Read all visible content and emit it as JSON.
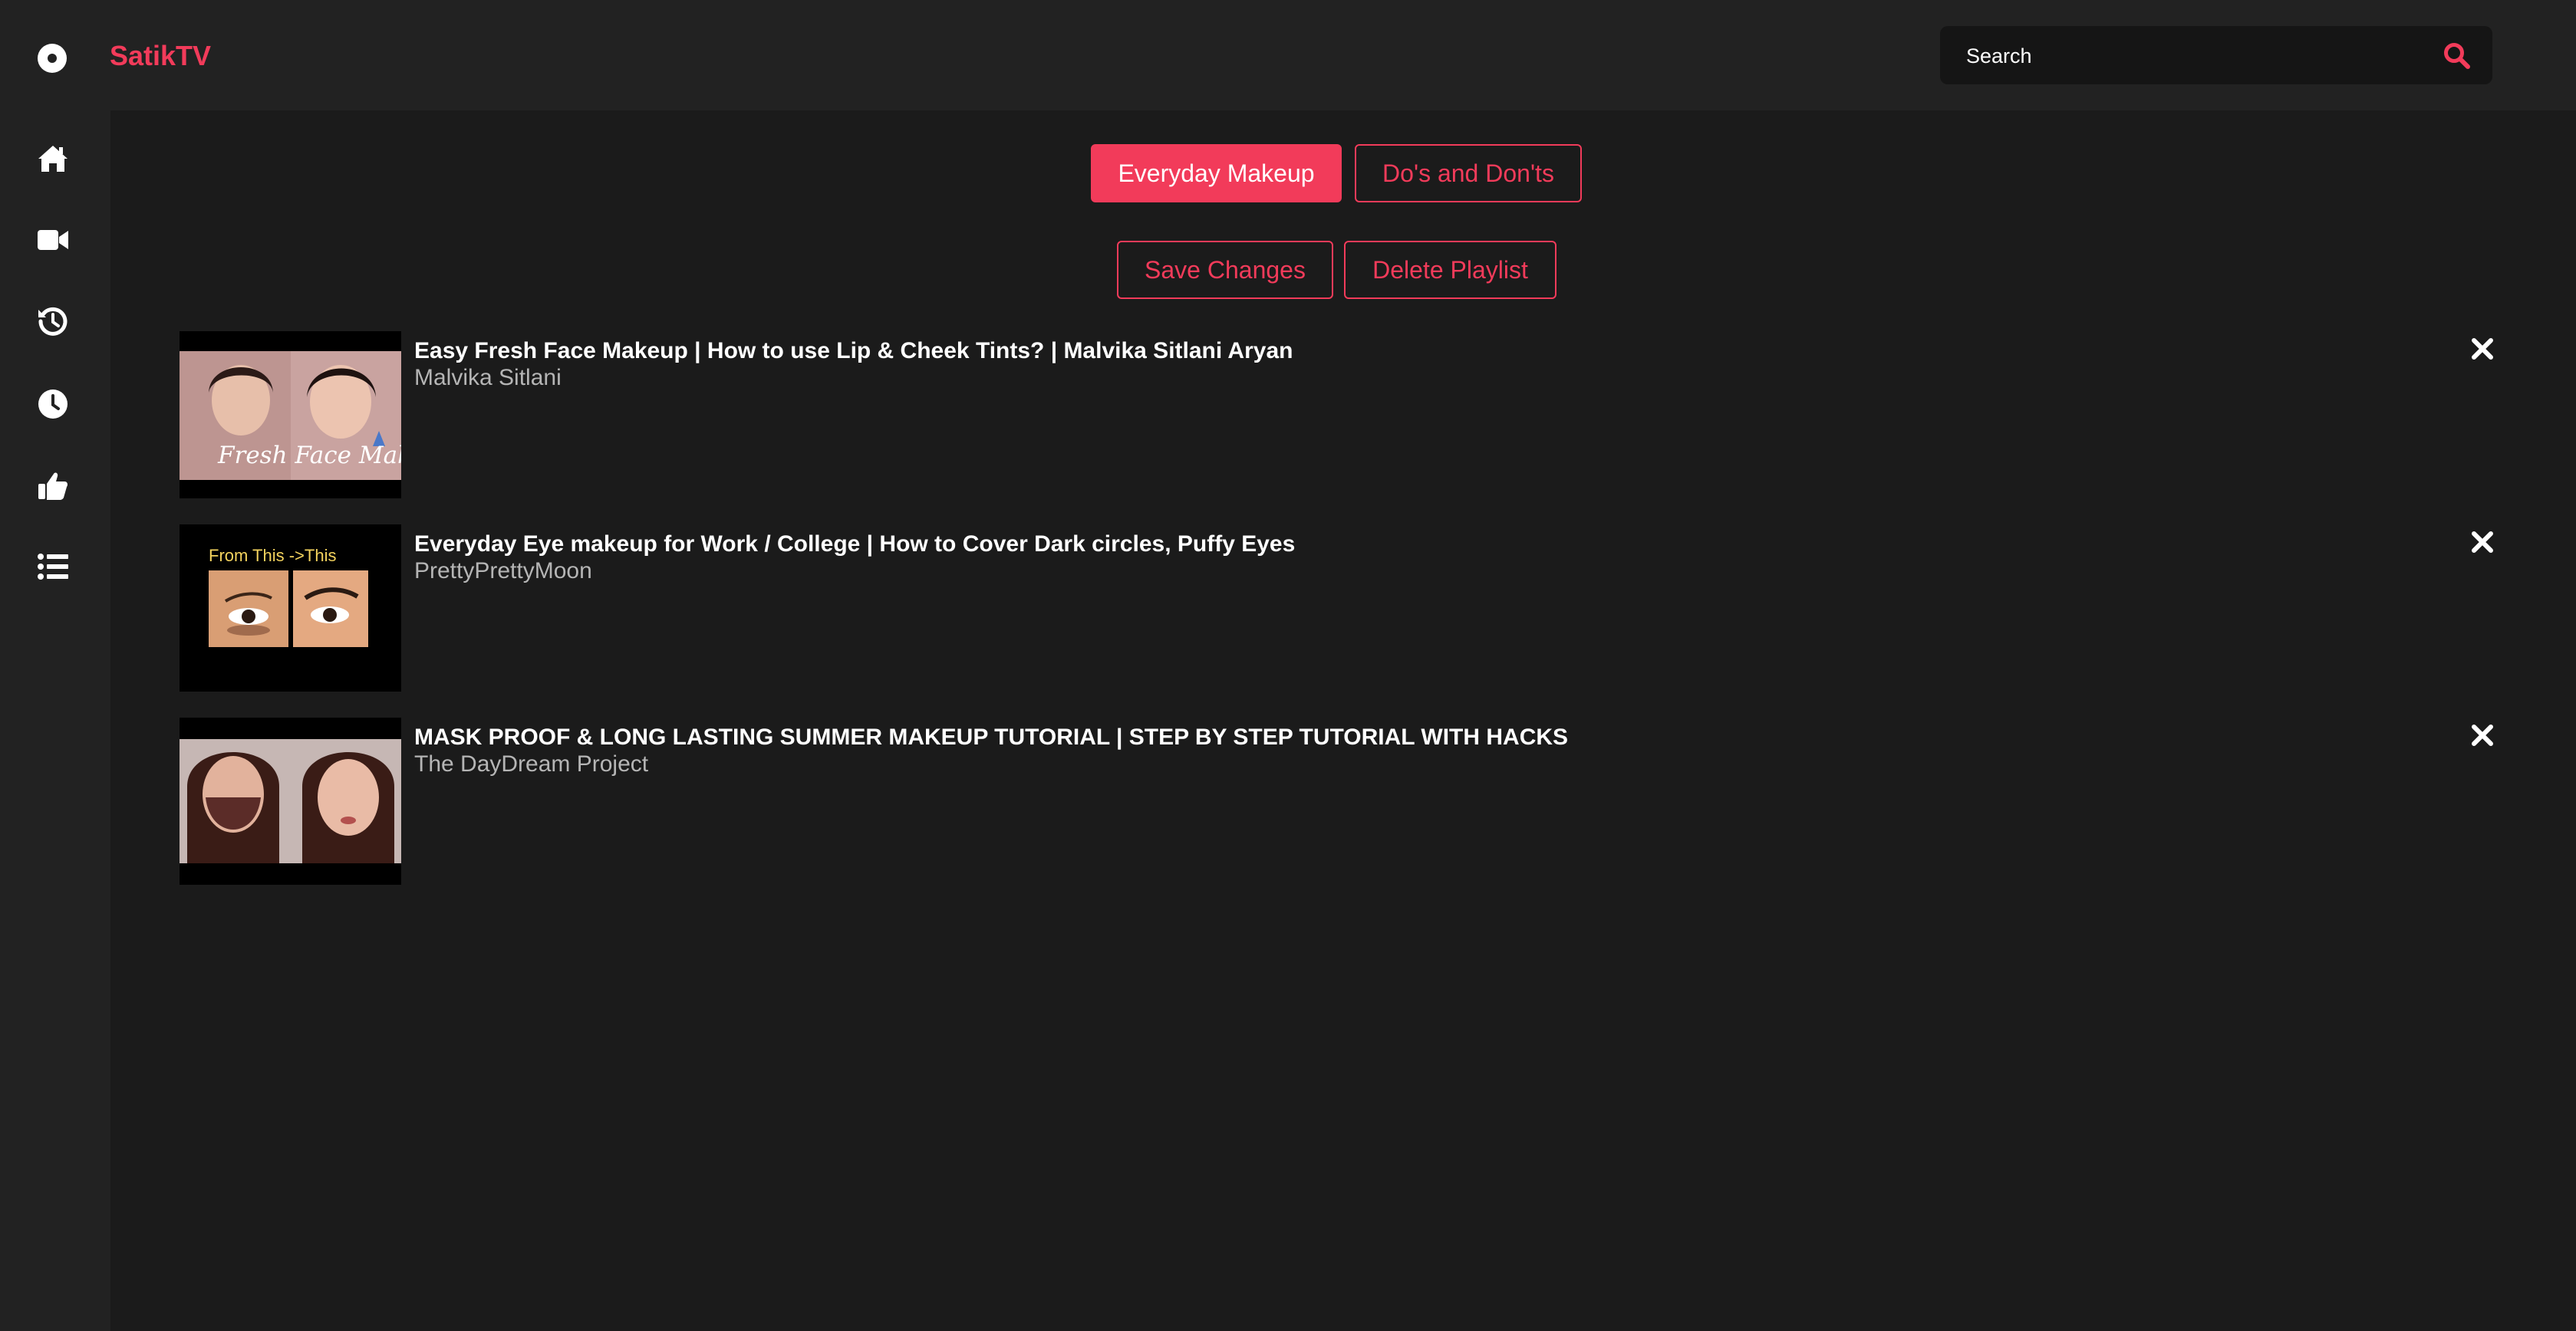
{
  "app": {
    "title": "SatikTV",
    "logo_icon": "disc-icon",
    "accent_color": "#f23b5a"
  },
  "search": {
    "placeholder": "Search",
    "icon": "search-icon"
  },
  "sidebar": {
    "items": [
      {
        "name": "home",
        "icon": "home-icon"
      },
      {
        "name": "videos",
        "icon": "video-camera-icon"
      },
      {
        "name": "history",
        "icon": "history-icon"
      },
      {
        "name": "watch-later",
        "icon": "clock-icon"
      },
      {
        "name": "liked",
        "icon": "thumbs-up-icon"
      },
      {
        "name": "playlists",
        "icon": "list-icon"
      }
    ]
  },
  "playlist_tabs": [
    {
      "label": "Everyday Makeup",
      "active": true
    },
    {
      "label": "Do's and Don'ts",
      "active": false
    }
  ],
  "actions": {
    "save_label": "Save Changes",
    "delete_label": "Delete Playlist"
  },
  "videos": [
    {
      "title": "Easy Fresh Face Makeup | How to use Lip & Cheek Tints? | Malvika Sitlani Aryan",
      "channel": "Malvika Sitlani",
      "thumb_text": "Fresh Face Makeup"
    },
    {
      "title": "Everyday Eye makeup for Work / College | How to Cover Dark circles, Puffy Eyes",
      "channel": "PrettyPrettyMoon",
      "thumb_text": "From This ->This"
    },
    {
      "title": "MASK PROOF & LONG LASTING SUMMER MAKEUP TUTORIAL | STEP BY STEP TUTORIAL WITH HACKS",
      "channel": "The DayDream Project",
      "thumb_text": ""
    }
  ]
}
